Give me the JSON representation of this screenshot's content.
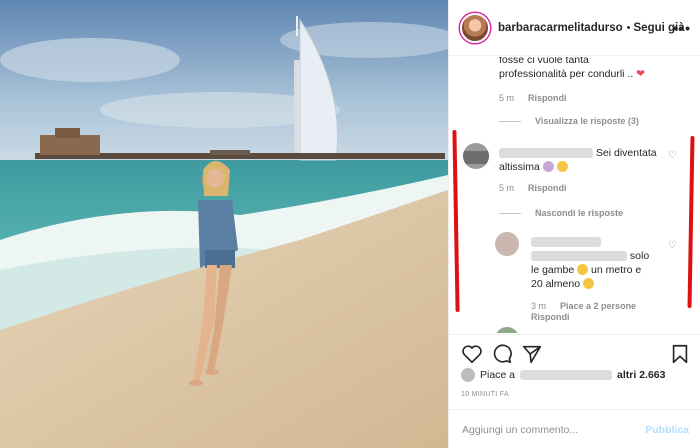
{
  "post": {
    "username": "barbaracarmelitadurso",
    "separator": "•",
    "follow_label": "Segui già",
    "more_icon": "more-options-icon"
  },
  "comments": {
    "c0": {
      "text_line1": "fosse ci vuole tanta",
      "text_line2": "professionalità per condurli ..",
      "time": "5 m",
      "reply": "Rispondi"
    },
    "view_replies": "Visualizza le risposte (3)",
    "c1": {
      "text_tail": "Sei diventata",
      "text_line2": "altissima",
      "time": "5 m",
      "reply": "Rispondi"
    },
    "hide_replies": "Nascondi le risposte",
    "c2": {
      "text_tail": "solo",
      "text_line2": "le gambe",
      "text_line2b": "un metro e",
      "text_line3": "20 almeno",
      "time": "3 m",
      "likes": "Piace a 2 persone",
      "reply": "Rispondi"
    }
  },
  "likes": {
    "prefix": "Piace a",
    "suffix": "altri 2.663"
  },
  "timestamp": "10 MINUTI FA",
  "add_comment": {
    "placeholder": "Aggiungi un commento...",
    "publish": "Pubblica"
  },
  "colors": {
    "heart": "#ed4956",
    "annotation": "#dd1111",
    "publish_disabled": "#b2dffc"
  }
}
